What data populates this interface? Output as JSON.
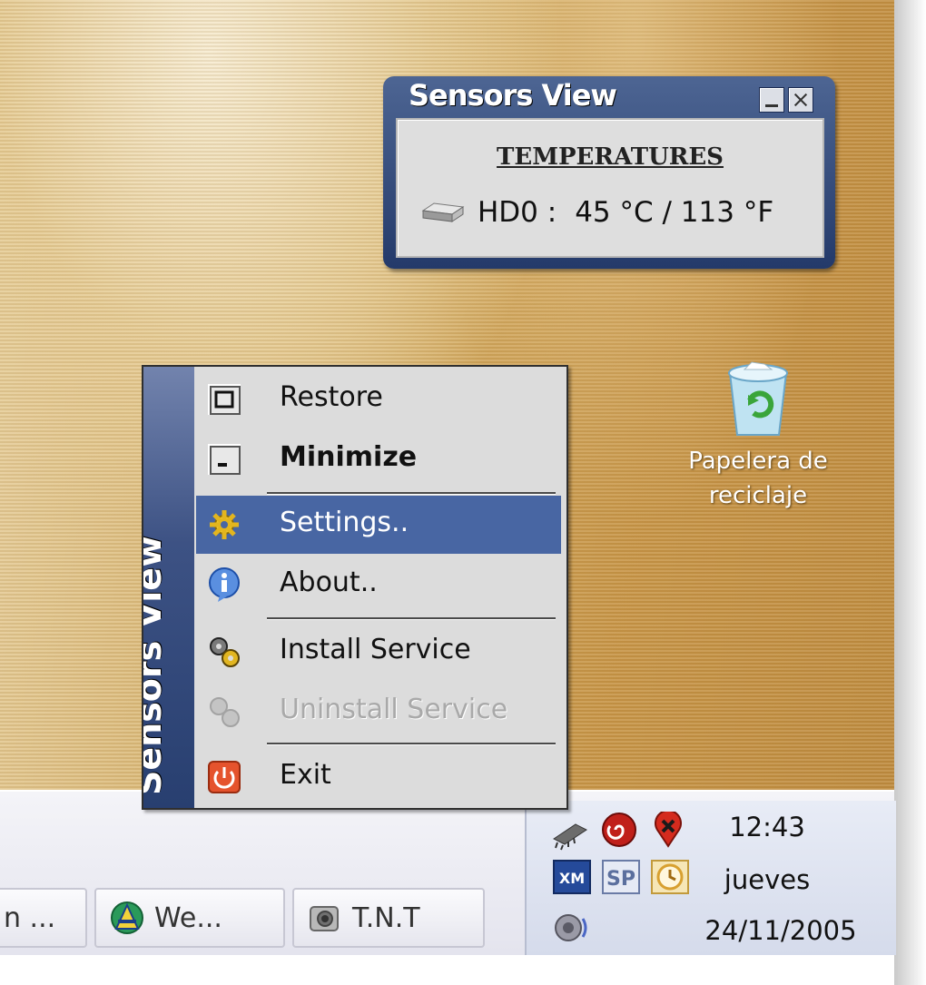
{
  "desktop": {
    "recycle_bin": {
      "label_line1": "Papelera de",
      "label_line2": "reciclaje",
      "icon": "recycle-bin-icon"
    }
  },
  "sensors_window": {
    "title": "Sensors View",
    "heading": "TEMPERATURES",
    "rows": [
      {
        "label": "HD0 :",
        "value": "45 °C / 113 °F",
        "icon": "hard-drive-icon"
      }
    ]
  },
  "context_menu": {
    "sidebar_title": "Sensors View",
    "items": [
      {
        "label": "Restore",
        "icon": "restore-window-icon",
        "state": "normal"
      },
      {
        "label": "Minimize",
        "icon": "minimize-window-icon",
        "state": "bold"
      },
      {
        "label": "Settings..",
        "icon": "settings-gear-icon",
        "state": "selected"
      },
      {
        "label": "About..",
        "icon": "info-icon",
        "state": "normal"
      },
      {
        "label": "Install Service",
        "icon": "gears-icon",
        "state": "normal"
      },
      {
        "label": "Uninstall Service",
        "icon": "gears-disabled-icon",
        "state": "disabled"
      },
      {
        "label": "Exit",
        "icon": "power-icon",
        "state": "normal"
      }
    ]
  },
  "taskbar": {
    "buttons": [
      {
        "label": "n ..."
      },
      {
        "label": "We...",
        "icon": "web-app-icon"
      },
      {
        "label": "T.N.T",
        "icon": "camera-icon"
      }
    ],
    "tray": {
      "icons": [
        "chip-icon",
        "red-spiral-icon",
        "red-pin-icon",
        "xm-icon",
        "sp-icon",
        "clock-icon",
        "speaker-icon"
      ],
      "time": "12:43",
      "day": "jueves",
      "date": "24/11/2005"
    }
  },
  "colors": {
    "menu_highlight": "#4866a3",
    "window_frame": "#2b4272",
    "menu_bg": "#dcdcdc"
  }
}
